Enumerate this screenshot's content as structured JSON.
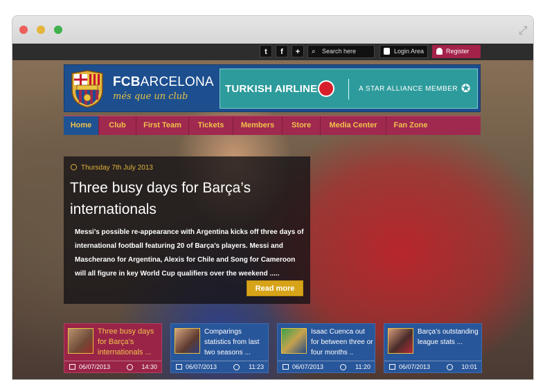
{
  "browser": {
    "expand_icon": "expand-icon"
  },
  "topbar": {
    "social": [
      {
        "name": "twitter-icon",
        "glyph": "t"
      },
      {
        "name": "facebook-icon",
        "glyph": "f"
      },
      {
        "name": "plus-icon",
        "glyph": "+"
      }
    ],
    "search_placeholder": "Search here",
    "login_label": "Login Area",
    "register_label": "Register"
  },
  "header": {
    "brand_bold": "FCB",
    "brand_rest": "ARCELONA",
    "motto": "més que un club",
    "ad": {
      "airline": "TURKISH AIRLINES",
      "tagline": "A STAR ALLIANCE MEMBER"
    }
  },
  "nav": {
    "items": [
      "Home",
      "Club",
      "First Team",
      "Tickets",
      "Members",
      "Store",
      "Media Center",
      "Fan Zone"
    ],
    "active": "Home"
  },
  "featured": {
    "date": "Thursday 7th July 2013",
    "headline": "Three busy days for Barça’s internationals",
    "summary": "Messi’s possible re-appearance with Argentina kicks off three days of international football featuring 20 of Barça’s players. Messi and Mascherano for Argentina, Alexis for Chile and Song for Cameroon will all figure in key World Cup qualifiers over the weekend .....",
    "read_more": "Read more"
  },
  "news": [
    {
      "title": "Three busy days for Barça’s internationals ...",
      "date": "06/07/2013",
      "time": "14:30"
    },
    {
      "title": "Comparings statistics from last two seasons ...",
      "date": "06/07/2013",
      "time": "11:23"
    },
    {
      "title": "Isaac Cuenca out for between three or four months ..",
      "date": "06/07/2013",
      "time": "11:20"
    },
    {
      "title": "Barça’s outstanding league stats ...",
      "date": "06/07/2013",
      "time": "10:01"
    }
  ],
  "colors": {
    "brand_blue": "#1d4f8f",
    "brand_claret": "#a0294f",
    "brand_gold": "#f1c24b"
  }
}
